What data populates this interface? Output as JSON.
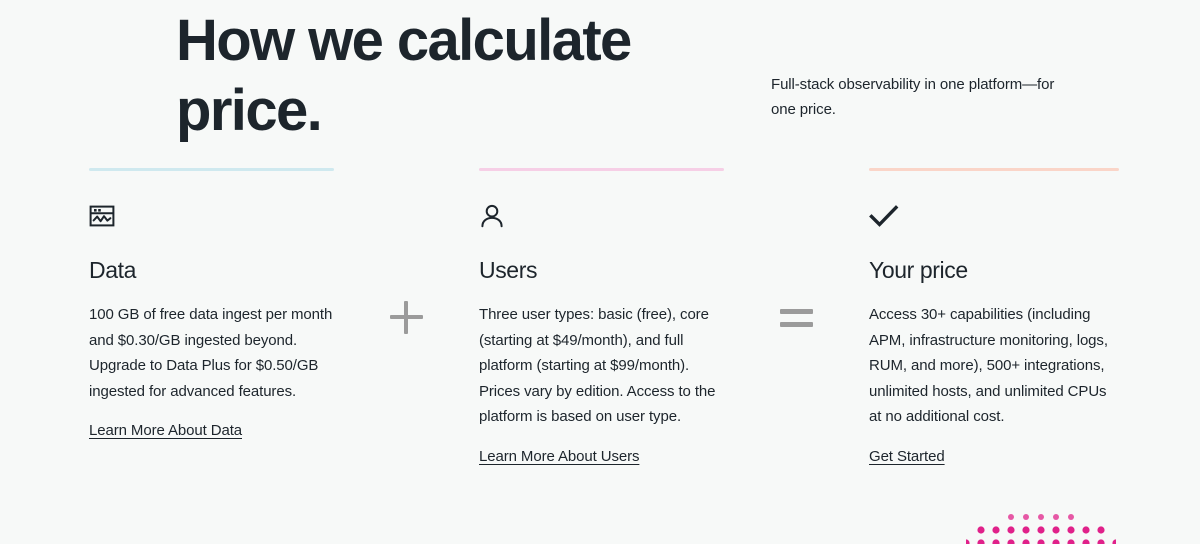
{
  "header": {
    "title": "How we calculate price.",
    "subtitle": "Full-stack observability in one platform—for one price."
  },
  "colors": {
    "background": "#f7f9f8",
    "text": "#1d252c",
    "rule_data": "#cfe9ef",
    "rule_users": "#f6cfe6",
    "rule_price": "#fad5c8",
    "operator": "#9b9b9b",
    "dot_accent": "#e0218a"
  },
  "operators": {
    "plus": "+",
    "equals": "="
  },
  "columns": [
    {
      "icon": "dashboard-chart-icon",
      "title": "Data",
      "body": "100 GB of free data ingest per month and $0.30/GB ingested beyond. Upgrade to Data Plus for $0.50/GB ingested for advanced features.",
      "link": "Learn More About Data",
      "rule_color": "#cfe9ef"
    },
    {
      "icon": "user-icon",
      "title": "Users",
      "body": "Three user types: basic (free), core (starting at $49/month), and full platform (starting at $99/month). Prices vary by edition. Access to the platform is based on user type.",
      "link": "Learn More About Users",
      "rule_color": "#f6cfe6"
    },
    {
      "icon": "checkmark-icon",
      "title": "Your price",
      "body": "Access 30+ capabilities (including APM, infrastructure monitoring, logs, RUM, and more), 500+ integrations, unlimited hosts, and unlimited CPUs at no additional cost.",
      "link": "Get Started",
      "rule_color": "#fad5c8"
    }
  ],
  "decoration": {
    "name": "dot-grid-arc"
  }
}
